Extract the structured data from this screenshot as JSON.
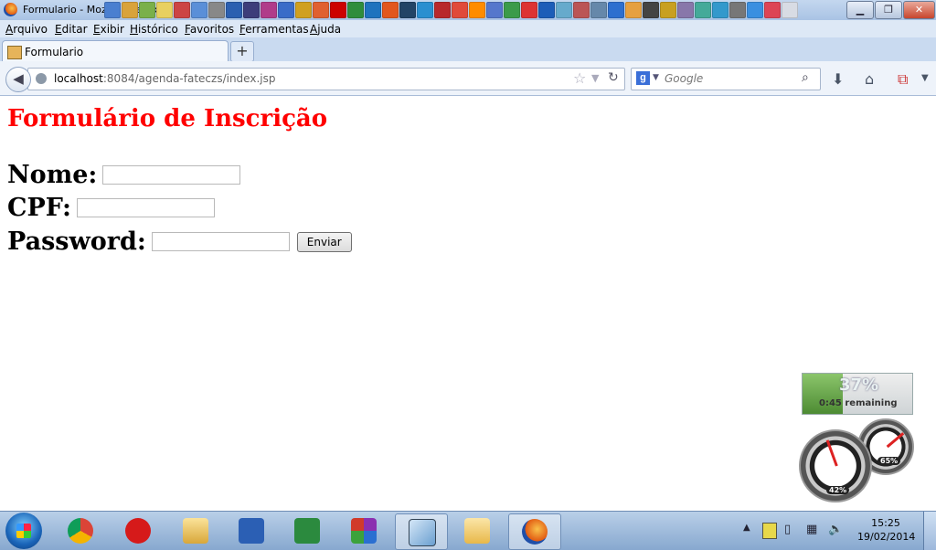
{
  "window": {
    "title": "Formulario - Mozilla Firefox",
    "minimize": "▁",
    "maximize": "❐",
    "close": "✕"
  },
  "menu": [
    "Arquivo",
    "Editar",
    "Exibir",
    "Histórico",
    "Favoritos",
    "Ferramentas",
    "Ajuda"
  ],
  "tab": {
    "label": "Formulario",
    "new_tab": "+"
  },
  "nav": {
    "back_icon": "back-arrow-icon",
    "url_host": "localhost",
    "url_rest": ":8084/agenda-fateczs/index.jsp",
    "search_engine": "g",
    "search_placeholder": "Google",
    "icons": [
      "download-icon",
      "home-icon",
      "addon-icon",
      "menu-dropdown-icon"
    ]
  },
  "page": {
    "title": "Formulário de Inscrição",
    "fields": [
      {
        "label": "Nome:",
        "value": ""
      },
      {
        "label": "CPF:",
        "value": ""
      },
      {
        "label": "Password:",
        "value": ""
      }
    ],
    "submit_label": "Enviar"
  },
  "gadgets": {
    "battery_percent": "37%",
    "battery_remaining": "0:45 remaining",
    "battery_level": 0.37,
    "cpu_percent": "42%",
    "memory_percent": "65%"
  },
  "taskbar": {
    "apps": [
      "start-button",
      "chrome-icon",
      "claro-icon",
      "mail-icon",
      "word-icon",
      "excel-icon",
      "winrar-icon",
      "virtualbox-icon",
      "explorer-icon",
      "firefox-icon"
    ],
    "time": "15:25",
    "date": "19/02/2014"
  },
  "colors": {
    "title_red": "#ff0000",
    "chrome_blue": "#c9daf0"
  }
}
